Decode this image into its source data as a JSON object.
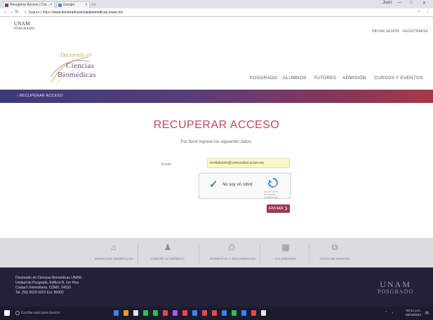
{
  "browser": {
    "tabs": [
      {
        "label": "Recuperar Acceso | Cie...",
        "icon_color": "#8a3558",
        "active": true
      },
      {
        "label": "Google",
        "icon_color": "#4285f4",
        "active": false
      }
    ],
    "url_scheme": "ⓘ Seguro | https://",
    "url_host": "www.doctoradocienciasbiomedicas.unam.mx",
    "window_controls": [
      "Juan",
      "—",
      "□",
      "✕"
    ],
    "address_right": [
      "☆",
      "⋮"
    ]
  },
  "site": {
    "unam_mini": [
      "UNAM",
      "POSGRADO"
    ],
    "top_links": [
      "INICIAR SESIÓN",
      "REGISTRARSE"
    ],
    "logo": {
      "line0": "Doctorado en",
      "line1": "Ciencias",
      "line2": "Biomédicas"
    },
    "nav": [
      "POSGRADO",
      "ALUMNOS",
      "TUTORES",
      "ADMISIÓN",
      "CURSOS Y EVENTOS"
    ]
  },
  "breadcrumb": "› RECUPERAR ACCESO",
  "form": {
    "title": "RECUPERAR ACCESO",
    "subtitle": "Por favor ingrese los siguientes datos:",
    "email_label": "Email",
    "email_value": "mvillafuerte@comunidad.unam.mx",
    "captcha": {
      "text": "No soy un robot",
      "brand": "reCAPTCHA",
      "terms": "Privacidad - Condiciones"
    },
    "submit_label": "ENVIAR ❯"
  },
  "quicklinks": [
    {
      "label": "SERVICIOS GENERALES",
      "icon": "building-icon",
      "glyph": "⌂"
    },
    {
      "label": "COMITÉ ACADÉMICO",
      "icon": "people-icon",
      "glyph": "♟"
    },
    {
      "label": "FORMATOS Y DOCUMENTOS",
      "icon": "document-icon",
      "glyph": "⎙"
    },
    {
      "label": "CALENDARIO",
      "icon": "calendar-icon",
      "glyph": "▦"
    },
    {
      "label": "LIGAS DE INTERÉS",
      "icon": "link-icon",
      "glyph": "⧉"
    }
  ],
  "footer": {
    "lines": [
      "Doctorado en Ciencias Biomédicas UNAM",
      "Unidad de Posgrado, Edificio B, 1er Piso",
      "Ciudad Universitaria, CDMX, 04510",
      "Tel. (55) 5623-0222 Ext. 80000"
    ],
    "logo_l1": "UNAM",
    "logo_l2": "POSGRADO"
  },
  "taskbar": {
    "search_placeholder": "Escribe aquí para buscar",
    "time": "09:41 a.m.",
    "date": "05/10/2017",
    "app_colors": [
      "#3b82f6",
      "#f59e0b",
      "#e5e7eb",
      "#22c55e",
      "#22c55e",
      "#ef4444",
      "#a855f7",
      "#ef4444",
      "#3b82f6",
      "#ef4444",
      "#ef4444",
      "#3b82f6",
      "#22c55e",
      "#3b82f6",
      "#ef4444",
      "#e5e7eb"
    ]
  },
  "colors": {
    "accent": "#9b3a52",
    "title": "#c04a5a",
    "footer_bg": "#23213a"
  }
}
